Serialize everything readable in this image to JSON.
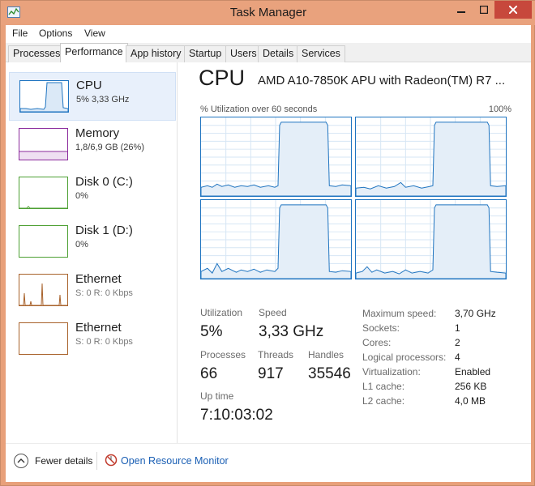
{
  "window": {
    "title": "Task Manager"
  },
  "colors": {
    "cpu_accent": "#1f74c0",
    "memory_accent": "#8b2a9c",
    "disk_accent": "#4da033",
    "ethernet_accent": "#a8622b",
    "link": "#1a5fb4"
  },
  "menu": [
    "File",
    "Options",
    "View"
  ],
  "tabs": [
    "Processes",
    "Performance",
    "App history",
    "Startup",
    "Users",
    "Details",
    "Services"
  ],
  "active_tab": "Performance",
  "sidebar": [
    {
      "name": "CPU",
      "sub": "5% 3,33 GHz",
      "icon": "cpu-graph-thumb"
    },
    {
      "name": "Memory",
      "sub": "1,8/6,9 GB (26%)",
      "icon": "memory-graph-thumb"
    },
    {
      "name": "Disk 0 (C:)",
      "sub": "0%",
      "icon": "disk-graph-thumb"
    },
    {
      "name": "Disk 1 (D:)",
      "sub": "0%",
      "icon": "disk-graph-thumb"
    },
    {
      "name": "Ethernet",
      "sub_s": "S: 0",
      "sub_r": " R: 0 Kbps",
      "icon": "ethernet-graph-thumb"
    },
    {
      "name": "Ethernet",
      "sub_s": "S: 0",
      "sub_r": " R: 0 Kbps",
      "icon": "ethernet-graph-thumb"
    }
  ],
  "cpu": {
    "heading": "CPU",
    "model": "AMD A10-7850K APU with Radeon(TM) R7 ...",
    "graph_caption_left": "% Utilization over 60 seconds",
    "graph_caption_right": "100%",
    "stats": {
      "utilization_label": "Utilization",
      "utilization": "5%",
      "speed_label": "Speed",
      "speed": "3,33 GHz",
      "processes_label": "Processes",
      "processes": "66",
      "threads_label": "Threads",
      "threads": "917",
      "handles_label": "Handles",
      "handles": "35546",
      "uptime_label": "Up time",
      "uptime": "7:10:03:02"
    },
    "specs": [
      {
        "label": "Maximum speed:",
        "value": "3,70 GHz"
      },
      {
        "label": "Sockets:",
        "value": "1"
      },
      {
        "label": "Cores:",
        "value": "2"
      },
      {
        "label": "Logical processors:",
        "value": "4"
      },
      {
        "label": "Virtualization:",
        "value": "Enabled"
      },
      {
        "label": "L1 cache:",
        "value": "256 KB"
      },
      {
        "label": "L2 cache:",
        "value": "4,0 MB"
      }
    ]
  },
  "footer": {
    "fewer_details": "Fewer details",
    "resource_monitor": "Open Resource Monitor"
  }
}
